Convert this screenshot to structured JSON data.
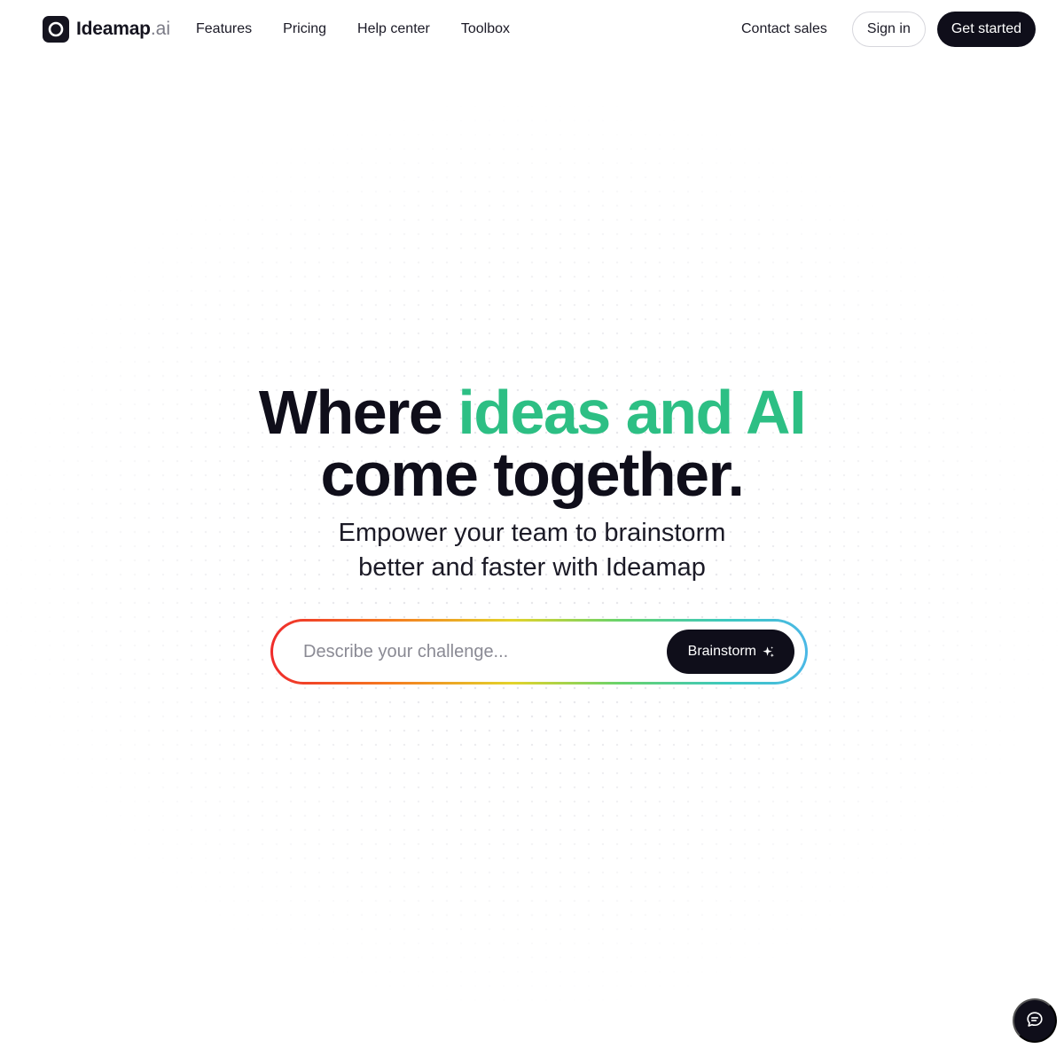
{
  "brand": {
    "name": "Ideamap",
    "tld": ".ai"
  },
  "nav": {
    "links": [
      {
        "label": "Features"
      },
      {
        "label": "Pricing"
      },
      {
        "label": "Help center"
      },
      {
        "label": "Toolbox"
      }
    ],
    "contact_label": "Contact sales",
    "signin_label": "Sign in",
    "get_started_label": "Get started"
  },
  "hero": {
    "headline_prefix": "Where ",
    "headline_accent": "ideas and AI",
    "headline_line2": "come together.",
    "subtitle_line1": "Empower your team to brainstorm",
    "subtitle_line2": "better and faster with Ideamap"
  },
  "search": {
    "placeholder": "Describe your challenge...",
    "value": "",
    "button_label": "Brainstorm"
  },
  "icons": {
    "logo": "ring-logo-icon",
    "sparkle": "sparkle-icon",
    "chat": "chat-bubble-icon"
  },
  "colors": {
    "accent": "#2dbf84",
    "dark": "#0f0e1a"
  }
}
